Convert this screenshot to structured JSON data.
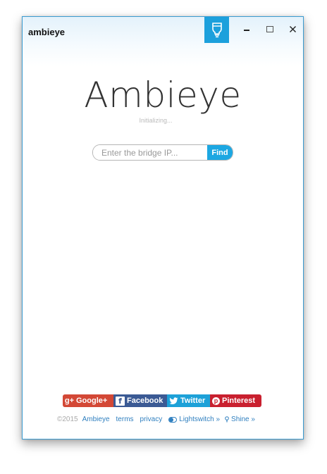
{
  "window": {
    "title": "ambieye"
  },
  "app": {
    "brand": "Ambieye",
    "status": "Initializing..."
  },
  "search": {
    "placeholder": "Enter the bridge IP...",
    "button_label": "Find"
  },
  "social": [
    {
      "label": "Google+",
      "icon": "google-plus-icon",
      "color": "#d34836"
    },
    {
      "label": "Facebook",
      "icon": "facebook-icon",
      "color": "#3b5a94"
    },
    {
      "label": "Twitter",
      "icon": "twitter-icon",
      "color": "#1da1d8"
    },
    {
      "label": "Pinterest",
      "icon": "pinterest-icon",
      "color": "#c9202f"
    }
  ],
  "footer": {
    "copyright": "©2015",
    "links": [
      "Ambieye",
      "terms",
      "privacy",
      "Lightswitch »",
      "Shine »"
    ]
  },
  "colors": {
    "accent": "#1ca0dc",
    "link": "#2f7fbf"
  }
}
